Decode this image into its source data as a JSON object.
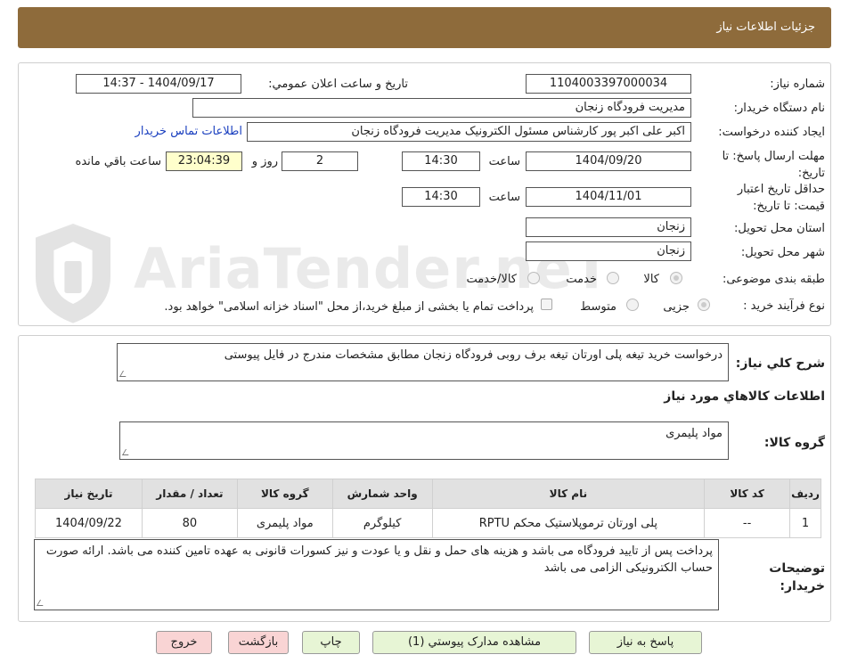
{
  "header": {
    "title": "جزئیات اطلاعات نیاز"
  },
  "form": {
    "need_number_label": "شماره نیاز:",
    "need_number": "1104003397000034",
    "announce_label": "تاریخ و ساعت اعلان عمومي:",
    "announce_value": "1404/09/17 - 14:37",
    "buyer_org_label": "نام دستگاه خریدار:",
    "buyer_org": "مدیریت فرودگاه زنجان",
    "requester_label": "ایجاد کننده درخواست:",
    "requester": "اکبر علی اکبر پور کارشناس مسئول الکترونیک مدیریت فرودگاه زنجان",
    "contact_link": "اطلاعات تماس خریدار",
    "deadline_label": "مهلت ارسال پاسخ: تا تاریخ:",
    "deadline_date": "1404/09/20",
    "time_label": "ساعت",
    "deadline_time": "14:30",
    "days_value": "2",
    "days_label": "روز و",
    "remaining_value": "23:04:39",
    "remaining_label": "ساعت باقي مانده",
    "validity_label": "حداقل تاریخ اعتبار قیمت: تا تاریخ:",
    "validity_date": "1404/11/01",
    "validity_time": "14:30",
    "province_label": "استان محل تحویل:",
    "province": "زنجان",
    "city_label": "شهر محل تحویل:",
    "city": "زنجان",
    "category_label": "طبقه بندی موضوعی:",
    "category_options": [
      "کالا",
      "خدمت",
      "کالا/خدمت"
    ],
    "process_label": "نوع فرآیند خرید :",
    "process_options": [
      "جزیی",
      "متوسط"
    ],
    "treasury_text": "پرداخت تمام یا بخشی از مبلغ خرید،از محل \"اسناد خزانه اسلامی\" خواهد بود."
  },
  "description": {
    "label": "شرح کلي نياز:",
    "text": "درخواست خرید تیغه پلی اورتان تیغه برف روبی فرودگاه زنجان مطابق مشخصات مندرج در فایل پیوستی"
  },
  "goods": {
    "section_title": "اطلاعات کالاهاي مورد نياز",
    "group_label": "گروه کالا:",
    "group_value": "مواد پلیمری"
  },
  "table": {
    "headers": [
      "ردیف",
      "کد کالا",
      "نام کالا",
      "واحد شمارش",
      "گروه کالا",
      "تعداد / مقدار",
      "تاریخ نیاز"
    ],
    "rows": [
      [
        "1",
        "--",
        "پلی اورتان ترموپلاستیک محکم RPTU",
        "کیلوگرم",
        "مواد پلیمری",
        "80",
        "1404/09/22"
      ]
    ]
  },
  "notes": {
    "label": "توضیحات خریدار:",
    "text": "پرداخت پس از تایید فرودگاه می باشد و هزینه های حمل و نقل و یا عودت و نیز کسورات قانونی به عهده تامین کننده می باشد. ارائه صورت حساب الکترونیکی الزامی می باشد"
  },
  "buttons": {
    "reply": "پاسخ به نیاز",
    "attachments": "مشاهده مدارک پیوستي (1)",
    "print": "چاپ",
    "back": "بازگشت",
    "exit": "خروج"
  },
  "watermark": {
    "text": "AriaTender.neT"
  }
}
